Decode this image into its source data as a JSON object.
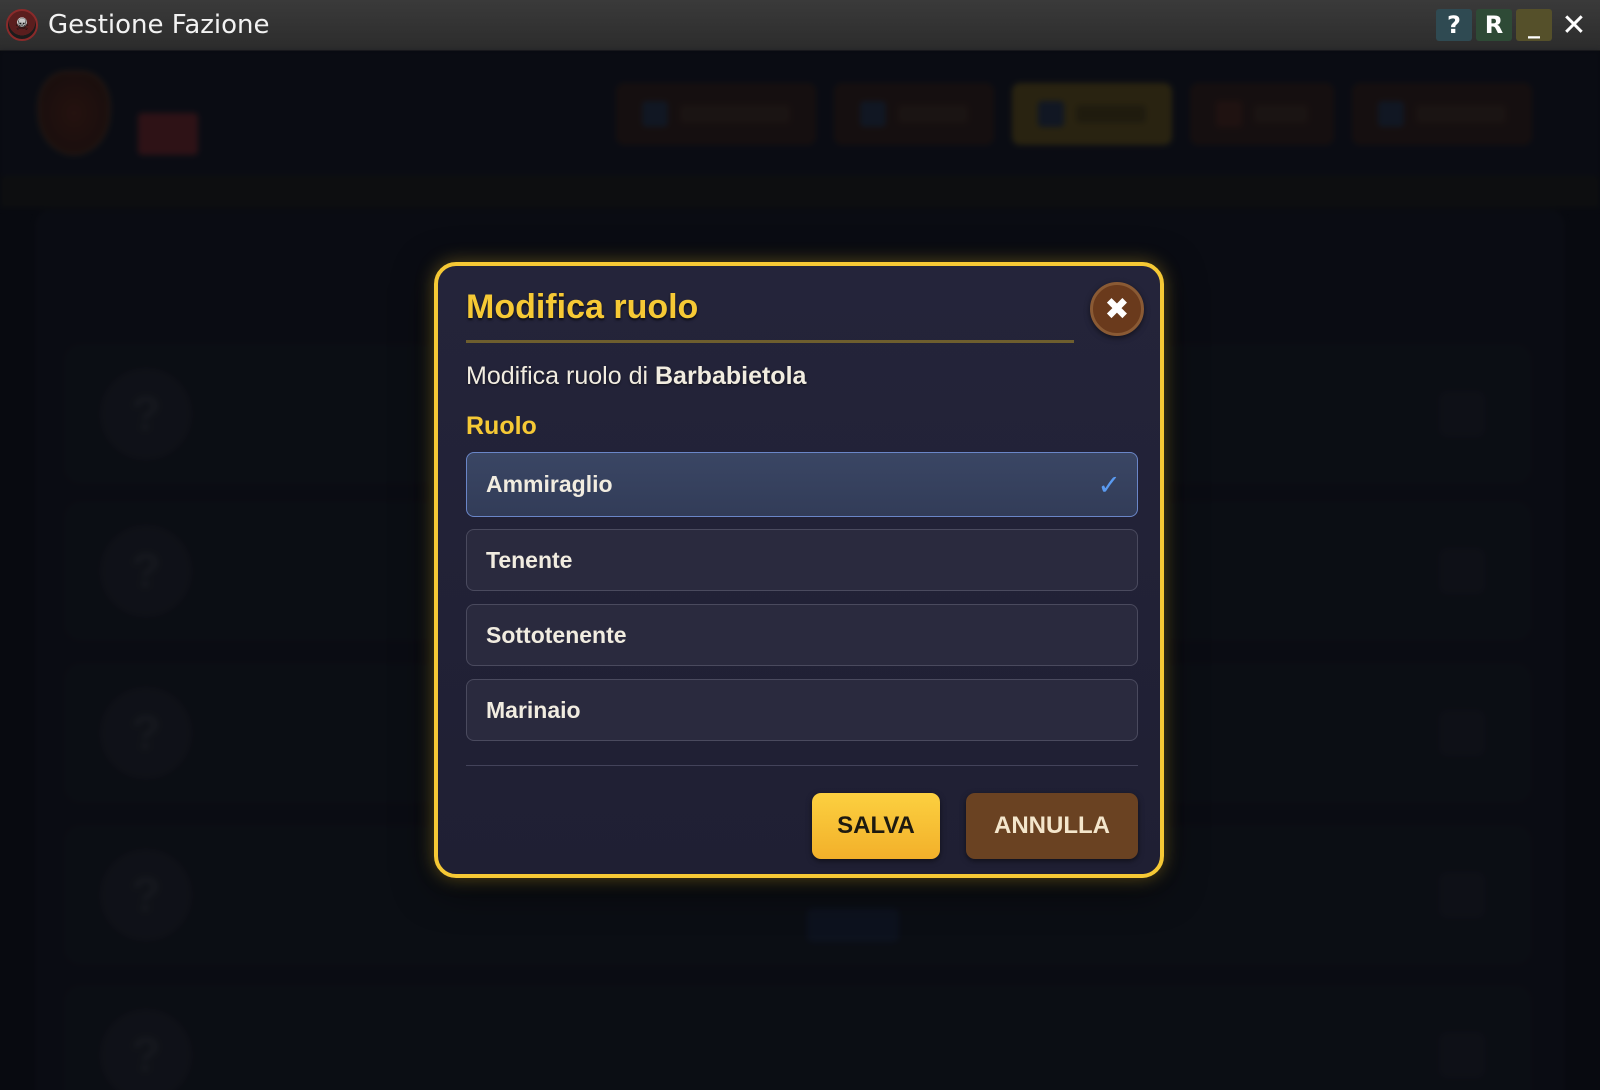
{
  "window": {
    "title": "Gestione Fazione",
    "controls": {
      "help": "?",
      "reset": "R",
      "minimize": "_",
      "close": "✕"
    }
  },
  "modal": {
    "title": "Modifica ruolo",
    "close_glyph": "✖",
    "subtitle_prefix": "Modifica ruolo di",
    "member_name": "Barbabietola",
    "field_label": "Ruolo",
    "roles": [
      {
        "label": "Ammiraglio",
        "selected": true
      },
      {
        "label": "Tenente",
        "selected": false
      },
      {
        "label": "Sottotenente",
        "selected": false
      },
      {
        "label": "Marinaio",
        "selected": false
      }
    ],
    "selected_check": "✓",
    "save_label": "SALVA",
    "cancel_label": "ANNULLA"
  },
  "colors": {
    "accent_gold": "#f6c935",
    "modal_bg": "#22223a",
    "selected_border": "#6a86c8",
    "check_blue": "#5a9af0",
    "cancel_brown": "#6a4222"
  }
}
